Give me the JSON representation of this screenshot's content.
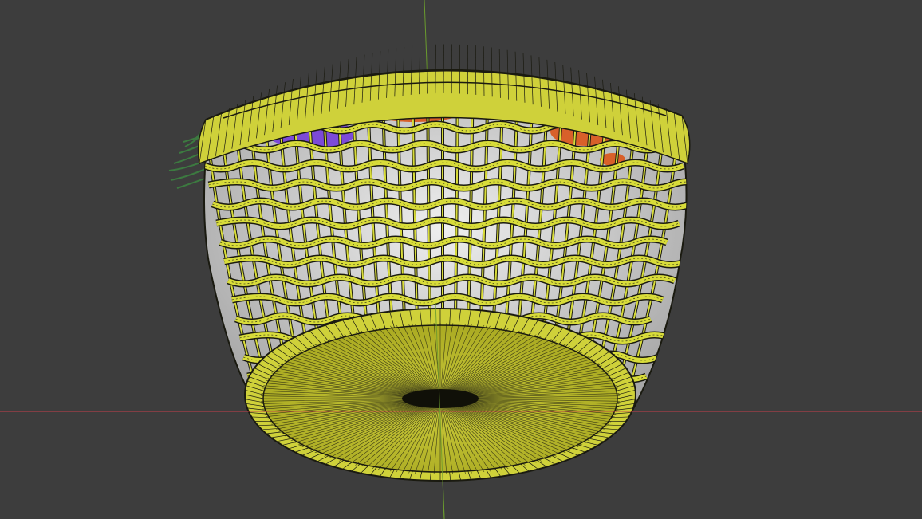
{
  "viewport": {
    "background": "#3d3d3d",
    "grid_visible": false
  },
  "axes": {
    "x_axis_color": "#c8404a",
    "y_axis_color": "#6a9b2e"
  },
  "object": {
    "name": "woven-basket",
    "display": "wireframe-overlay",
    "selected": true,
    "selection_color": "#d8dc3a",
    "wire_color": "#1a1a10",
    "interior_color": "#dcdcdc",
    "contents_colors": [
      "#7c4ad8",
      "#d8602a",
      "#3c7a40"
    ]
  }
}
